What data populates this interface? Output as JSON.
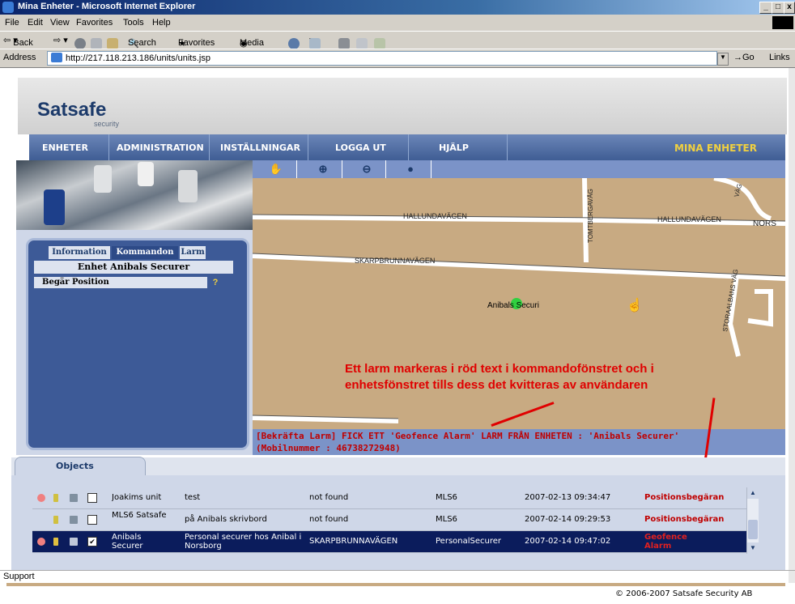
{
  "window": {
    "title": "Mina Enheter - Microsoft Internet Explorer",
    "controls": [
      "_",
      "□",
      "x"
    ]
  },
  "menu": [
    "File",
    "Edit",
    "View",
    "Favorites",
    "Tools",
    "Help"
  ],
  "toolbar": {
    "back": "Back",
    "search": "Search",
    "favorites": "Favorites",
    "media": "Media"
  },
  "address": {
    "label": "Address",
    "url": "http://217.118.213.186/units/units.jsp",
    "go": "Go",
    "links": "Links"
  },
  "brand": {
    "name": "Satsafe",
    "sub": "security"
  },
  "nav": {
    "items": [
      "ENHETER",
      "ADMINISTRATION",
      "INSTÄLLNINGAR",
      "LOGGA UT",
      "HJÄLP"
    ],
    "current": "MINA ENHETER"
  },
  "map_tools": [
    "hand-icon",
    "zoom-in-icon",
    "zoom-out-icon",
    "center-icon"
  ],
  "map": {
    "streets": [
      "HALLUNDAVÄGEN",
      "HALLUNDAVÄGEN",
      "NORS",
      "SKARPBRUNNAVÄGEN",
      "TOMTBERGAVÄG",
      "STORAALBANS VÄG",
      "VÄG"
    ],
    "unit_label": "Anibals Securi"
  },
  "alarm": {
    "message": "[Bekräfta Larm] FICK ETT 'Geofence Alarm' LARM FRÅN ENHETEN : 'Anibals Securer' (Mobilnummer : 46738272948)"
  },
  "annotation": {
    "line1": "Ett larm markeras i röd text i kommandofönstret och i",
    "line2": "enhetsfönstret tills dess det kvitteras av användaren"
  },
  "command_panel": {
    "tabs": [
      "Information",
      "Kommandon",
      "Larm"
    ],
    "active_tab": "Kommandon",
    "unit_title": "Enhet Anibals Securer",
    "commands": [
      "Begär Position"
    ],
    "help": "?"
  },
  "objects": {
    "tab_label": "Objects",
    "rows": [
      {
        "name": "Joakims unit",
        "desc": "test",
        "location": "not found",
        "type": "MLS6",
        "time": "2007-02-13 09:34:47",
        "status": "Positionsbegäran",
        "checked": false,
        "selected": false,
        "alarm": true
      },
      {
        "name": "MLS6 Satsafe",
        "desc": "på Anibals skrivbord",
        "location": "not found",
        "type": "MLS6",
        "time": "2007-02-14 09:29:53",
        "status": "Positionsbegäran",
        "checked": false,
        "selected": false,
        "alarm": false
      },
      {
        "name": "Anibals Securer",
        "desc": "Personal securer hos Anibal i Norsborg",
        "location": "SKARPBRUNNAVÄGEN",
        "type": "PersonalSecurer",
        "time": "2007-02-14 09:47:02",
        "status": "Geofence Alarm",
        "checked": true,
        "selected": true,
        "alarm": true
      }
    ]
  },
  "statusbar": {
    "text": "Support"
  },
  "footer": {
    "copyright": "© 2006-2007 Satsafe Security AB"
  },
  "colors": {
    "accent": "#3f5d94",
    "alarm": "#c00000",
    "map": "#c8aa82"
  }
}
